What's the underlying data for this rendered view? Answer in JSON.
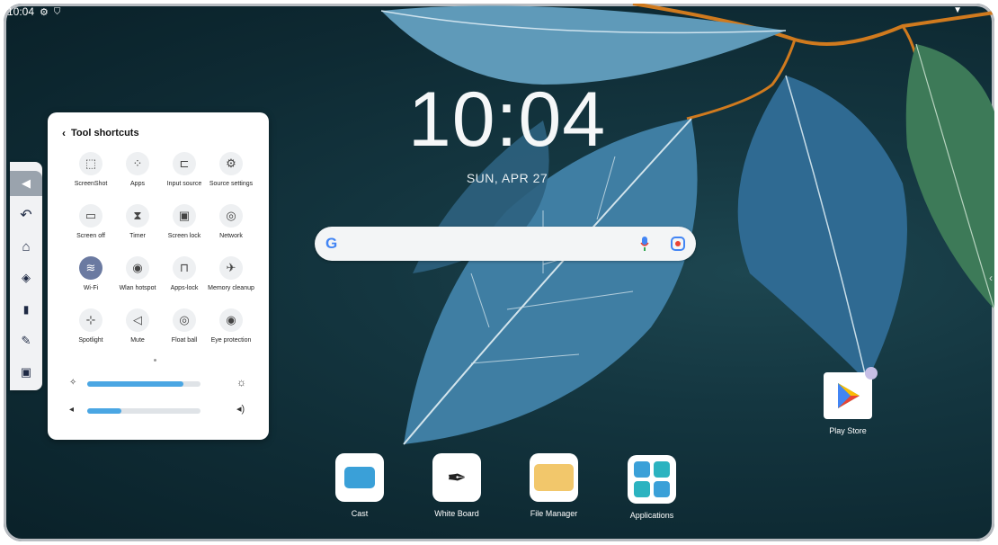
{
  "status_bar": {
    "time": "10:04"
  },
  "clock": {
    "time": "10:04",
    "date": "SUN, APR 27"
  },
  "panel": {
    "title": "Tool shortcuts",
    "tiles": [
      {
        "label": "ScreenShot",
        "icon": "screenshot-icon"
      },
      {
        "label": "Apps",
        "icon": "apps-icon"
      },
      {
        "label": "Input source",
        "icon": "input-source-icon"
      },
      {
        "label": "Source settings",
        "icon": "source-settings-icon"
      },
      {
        "label": "Screen off",
        "icon": "screen-off-icon"
      },
      {
        "label": "Timer",
        "icon": "timer-icon"
      },
      {
        "label": "Screen lock",
        "icon": "screen-lock-icon"
      },
      {
        "label": "Network",
        "icon": "network-icon"
      },
      {
        "label": "Wi-Fi",
        "icon": "wifi-icon"
      },
      {
        "label": "Wlan hotspot",
        "icon": "hotspot-icon"
      },
      {
        "label": "Apps-lock",
        "icon": "apps-lock-icon"
      },
      {
        "label": "Memory cleanup",
        "icon": "memory-cleanup-icon"
      },
      {
        "label": "Spotlight",
        "icon": "spotlight-icon"
      },
      {
        "label": "Mute",
        "icon": "mute-icon"
      },
      {
        "label": "Float ball",
        "icon": "float-ball-icon"
      },
      {
        "label": "Eye protection",
        "icon": "eye-protection-icon"
      }
    ],
    "brightness_level": 0.85,
    "volume_level": 0.3
  },
  "play_store": {
    "label": "Play Store"
  },
  "dock": [
    {
      "label": "Cast"
    },
    {
      "label": "White Board"
    },
    {
      "label": "File Manager"
    },
    {
      "label": "Applications"
    }
  ],
  "colors": {
    "accent": "#4aa6e3",
    "wifi_active": "#6b7aa1"
  }
}
